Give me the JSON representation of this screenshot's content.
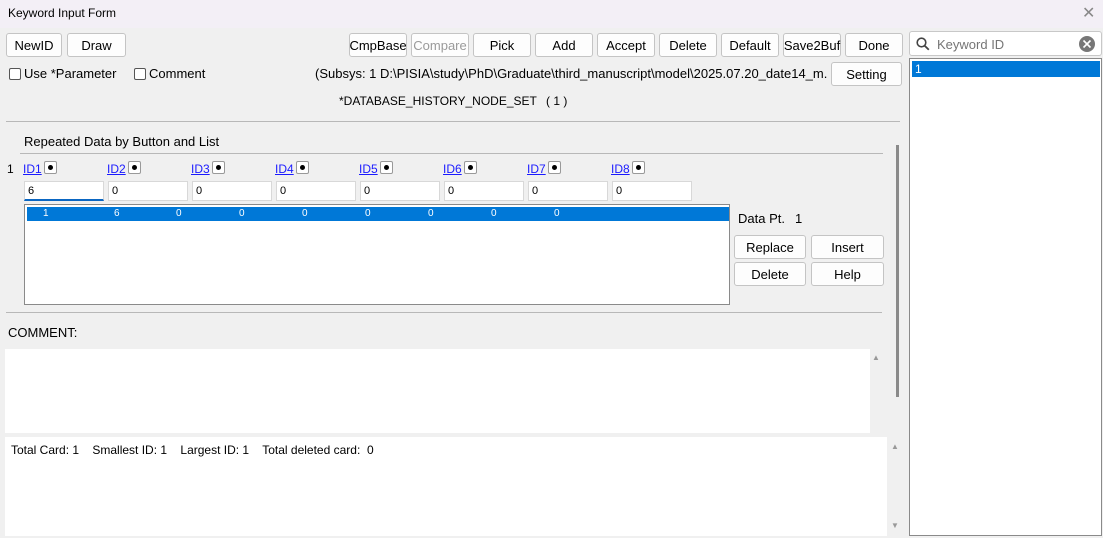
{
  "window": {
    "title": "Keyword Input Form"
  },
  "toolbar": {
    "newid": "NewID",
    "draw": "Draw",
    "cmpbase": "CmpBase",
    "compare": "Compare",
    "pick": "Pick",
    "add": "Add",
    "accept": "Accept",
    "delete": "Delete",
    "default": "Default",
    "save2buf": "Save2Buf",
    "done": "Done",
    "setting": "Setting"
  },
  "options": {
    "use_parameter": "Use *Parameter",
    "use_parameter_checked": false,
    "comment": "Comment",
    "comment_checked": false
  },
  "subsys_path": "(Subsys: 1 D:\\PISIA\\study\\PhD\\Graduate\\third_manuscript\\model\\2025.07.20_date14_m...",
  "keyword_heading": "*DATABASE_HISTORY_NODE_SET",
  "keyword_count": "( 1 )",
  "repeated": {
    "title": "Repeated Data by Button and List",
    "row_number": "1",
    "ids": [
      "ID1",
      "ID2",
      "ID3",
      "ID4",
      "ID5",
      "ID6",
      "ID7",
      "ID8"
    ],
    "values": [
      "6",
      "0",
      "0",
      "0",
      "0",
      "0",
      "0",
      "0"
    ],
    "list_rows": [
      {
        "cols": [
          "1",
          "6",
          "0",
          "0",
          "0",
          "0",
          "0",
          "0",
          "0"
        ]
      }
    ],
    "data_pt_label": "Data Pt.",
    "data_pt_value": "1",
    "replace": "Replace",
    "insert": "Insert",
    "delete": "Delete",
    "help": "Help"
  },
  "comment_section": {
    "label": "COMMENT:",
    "text": ""
  },
  "summary": "Total Card: 1    Smallest ID: 1    Largest ID: 1    Total deleted card:  0",
  "sidebar": {
    "search_placeholder": "Keyword ID",
    "items": [
      {
        "label": "1",
        "selected": true
      }
    ]
  },
  "colors": {
    "selection": "#0078d7",
    "link": "#1a1aff",
    "background": "#f0f0f0"
  }
}
